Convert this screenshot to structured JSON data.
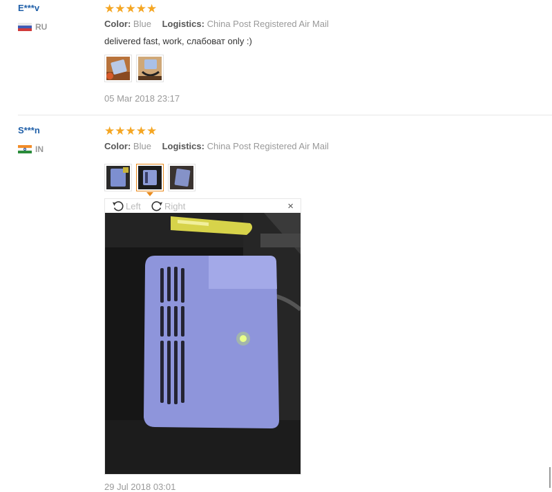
{
  "reviews": [
    {
      "user": "E***v",
      "country": "RU",
      "rating": "★★★★★",
      "color_label": "Color:",
      "color_value": "Blue",
      "logistics_label": "Logistics:",
      "logistics_value": "China Post Registered Air Mail",
      "text": "delivered fast, work, слабоват only :)",
      "date": "05 Mar 2018 23:17"
    },
    {
      "user": "S***n",
      "country": "IN",
      "rating": "★★★★★",
      "color_label": "Color:",
      "color_value": "Blue",
      "logistics_label": "Logistics:",
      "logistics_value": "China Post Registered Air Mail",
      "date": "29 Jul 2018 03:01"
    }
  ],
  "viewer": {
    "rotate_left": "Left",
    "rotate_right": "Right",
    "close": "×"
  },
  "colors": {
    "accent": "#e98a1c",
    "stars": "#f5a623",
    "username": "#1f5fa8"
  },
  "icons": [
    "rotate-left-icon",
    "rotate-right-icon",
    "close-icon",
    "star-icon"
  ]
}
